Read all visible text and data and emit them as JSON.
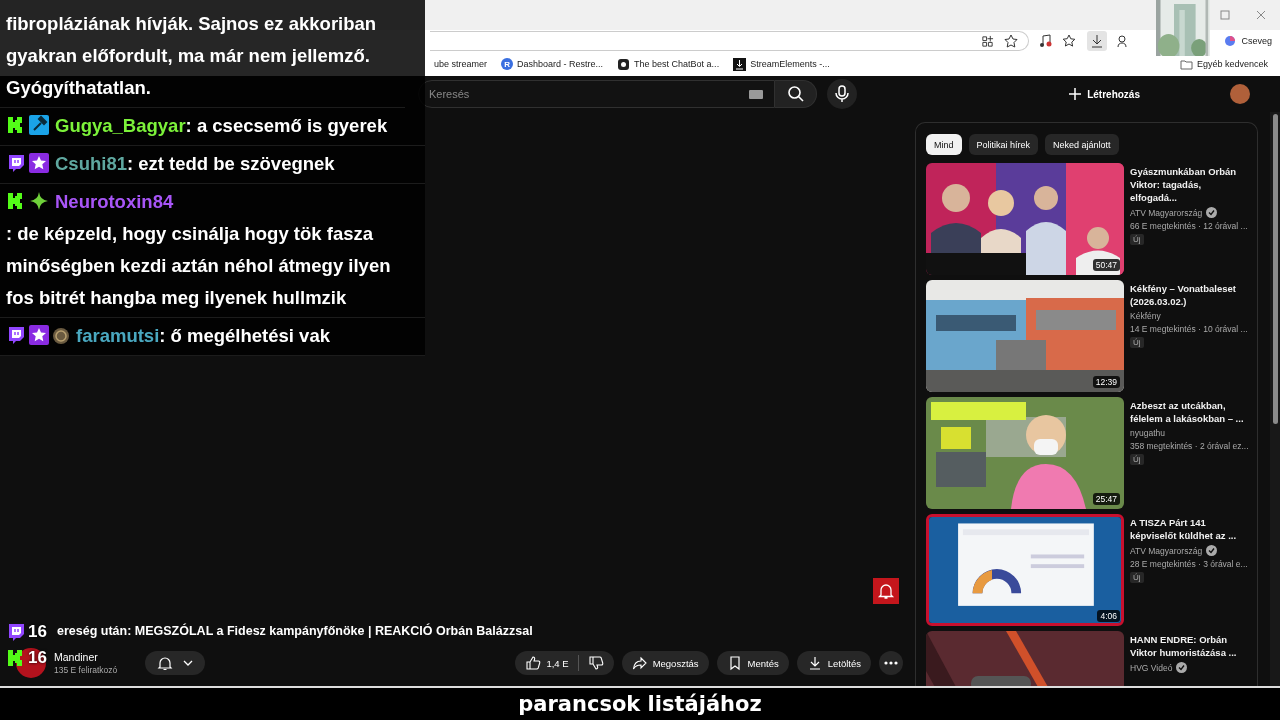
{
  "browser": {
    "bookmarks": [
      {
        "kind": "none",
        "label": "ube streamer"
      },
      {
        "kind": "letter",
        "icon_text": "R",
        "label": "Dashboard - Restre..."
      },
      {
        "kind": "bot",
        "label": "The best ChatBot a..."
      },
      {
        "kind": "download",
        "label": "StreamElements -..."
      }
    ],
    "other_bookmarks": "Egyéb kedvencek",
    "chat_button": "Cseveg"
  },
  "youtube": {
    "search": {
      "placeholder": "Keresés"
    },
    "create": "Létrehozás",
    "video": {
      "title": "ereség után: MEGSZÓLAL a Fidesz kampányfőnöke | REAKCIÓ Orbán Balázzsal",
      "channel": "Mandiner",
      "subscribers": "135 E feliratkozó",
      "likes": "1,4 E",
      "actions": [
        {
          "kind": "share",
          "label": "Megosztás"
        },
        {
          "kind": "save",
          "label": "Mentés"
        },
        {
          "kind": "download",
          "label": "Letöltés"
        }
      ]
    },
    "chips": [
      {
        "label": "Mind",
        "selected": true
      },
      {
        "label": "Politikai hírek",
        "selected": false
      },
      {
        "label": "Neked ajánlott",
        "selected": false
      }
    ],
    "recommendations": [
      {
        "title": "Gyászmunkában Orbán Viktor: tagadás, elfogadá...",
        "channel": "ATV Magyarország",
        "verified": true,
        "stats": "66 E megtekintés · 12 órával ...",
        "badge": "Új",
        "duration": "50:47",
        "selected": false
      },
      {
        "title": "Kékfény – Vonatbaleset (2026.03.02.)",
        "channel": "Kékfény",
        "verified": false,
        "stats": "14 E megtekintés · 10 órával ...",
        "badge": "Új",
        "duration": "12:39",
        "selected": false
      },
      {
        "title": "Azbeszt az utcákban, félelem a lakásokban – ...",
        "channel": "nyugathu",
        "verified": false,
        "stats": "358 megtekintés · 2 órával ez...",
        "badge": "Új",
        "duration": "25:47",
        "selected": false
      },
      {
        "title": "A TISZA Párt 141 képviselőt küldhet az ...",
        "channel": "ATV Magyarország",
        "verified": true,
        "stats": "28 E megtekintés · 3 órával e...",
        "badge": "Új",
        "duration": "4:06",
        "selected": true
      },
      {
        "title": "HANN ENDRE: Orbán Viktor humoristázása ...",
        "channel": "HVG Videó",
        "verified": true,
        "selected": false
      }
    ]
  },
  "chat": {
    "messages": [
      {
        "kind": "continuation",
        "text": "fibropláziának hívják. Sajnos ez akkoriban gyakran előfordult, ma már nem jellemző. Gyógyíthatatlan."
      },
      {
        "kind": "message",
        "badges": [
          {
            "kind": "kick"
          },
          {
            "kind": "mod"
          }
        ],
        "user": "Gugya_Bagyar",
        "color": "#7cf23a",
        "text": ": a csecsemő is gyerek"
      },
      {
        "kind": "message",
        "badges": [
          {
            "kind": "twitch"
          },
          {
            "kind": "star"
          }
        ],
        "user": "Csuhi81",
        "color": "#5fa8a0",
        "text": ": ezt tedd be szövegnek"
      },
      {
        "kind": "message",
        "badges": [
          {
            "kind": "kick"
          },
          {
            "kind": "sparkle"
          }
        ],
        "user": "Neurotoxin84",
        "color": "#a855f7",
        "text": ": de képzeld, hogy csinálja hogy tök fasza minőségben kezdi aztán néhol átmegy ilyen fos bitrét hangba meg ilyenek hullmzik"
      },
      {
        "kind": "message",
        "badges": [
          {
            "kind": "twitch"
          },
          {
            "kind": "star"
          },
          {
            "kind": "coin"
          }
        ],
        "user": "faramutsi",
        "color": "#4aa8c0",
        "text": ": ő megélhetési vak"
      }
    ]
  },
  "viewers": [
    {
      "kind": "twitch",
      "count": "16"
    },
    {
      "kind": "kick",
      "count": "16"
    }
  ],
  "caption": "parancsok listájához"
}
